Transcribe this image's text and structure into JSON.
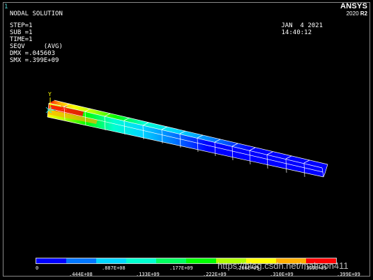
{
  "window_number": "1",
  "plot_title": "NODAL SOLUTION",
  "info": [
    "STEP=1",
    "SUB =1",
    "TIME=1",
    "SEQV     (AVG)",
    "DMX =.045603",
    "SMX =.399E+09"
  ],
  "logo": {
    "brand": "ANSYS",
    "version_prefix": "2020 ",
    "version_suffix": "R2"
  },
  "date": "JAN  4 2021",
  "time": "14:40:12",
  "axis_label": "Y",
  "contour": {
    "colors": [
      "#0000ff",
      "#0077ff",
      "#00d7ff",
      "#00ffd0",
      "#00ff60",
      "#00ff00",
      "#b0ff00",
      "#ffff00",
      "#ffb000",
      "#ff0000"
    ],
    "labels_top": [
      "0",
      ".887E+08",
      ".177E+09",
      ".266E+09",
      ".355E+09"
    ],
    "labels_bottom": [
      ".444E+08",
      ".133E+09",
      ".222E+09",
      ".310E+09",
      ".399E+09"
    ]
  },
  "watermark": "https://blog.csdn.net/mahoon411",
  "beam": {
    "max_stress_color": "#ff0000",
    "mesh_color": "#ffffff",
    "base_color": "#0000ff"
  }
}
